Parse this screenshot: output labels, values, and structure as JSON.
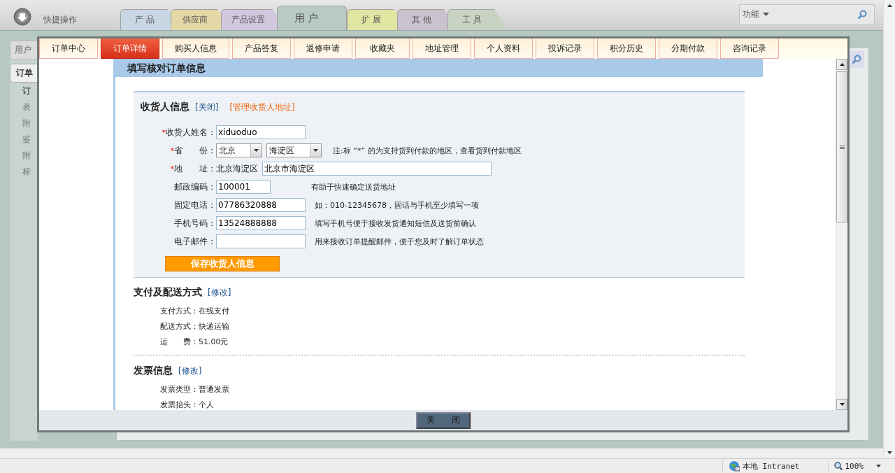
{
  "toolbar": {
    "quick_label": "快捷操作",
    "tabs": [
      {
        "label": "产 品",
        "selected": false,
        "color": "#c9d7e4"
      },
      {
        "label": "供应商",
        "selected": false,
        "color": "#e6d8a6"
      },
      {
        "label": "产品设置",
        "selected": false,
        "color": "#d2c8de"
      },
      {
        "label": "用 户",
        "selected": true,
        "color": "#b9cac2"
      },
      {
        "label": "扩 展",
        "selected": false,
        "color": "#e0e5a2"
      },
      {
        "label": "其 他",
        "selected": false,
        "color": "#cac2ce"
      },
      {
        "label": "工 具",
        "selected": false,
        "color": "#c9d3c4"
      }
    ],
    "search": {
      "label": "功能"
    }
  },
  "sidebar": {
    "title": "用户",
    "tab": {
      "label": "订单",
      "selected": true
    },
    "items": [
      {
        "label": "订",
        "kind": "heading"
      },
      {
        "label": "表",
        "kind": "link"
      },
      {
        "label": "附",
        "kind": "link"
      },
      {
        "label": "鉴",
        "kind": "link"
      },
      {
        "label": "附",
        "kind": "link"
      },
      {
        "label": "标",
        "kind": "link"
      }
    ]
  },
  "dialog": {
    "tabs": [
      {
        "label": "订单中心",
        "selected": false
      },
      {
        "label": "订单详情",
        "selected": true
      },
      {
        "label": "购买人信息",
        "selected": false
      },
      {
        "label": "产品答复",
        "selected": false
      },
      {
        "label": "返修申请",
        "selected": false
      },
      {
        "label": "收藏夹",
        "selected": false
      },
      {
        "label": "地址管理",
        "selected": false
      },
      {
        "label": "个人资料",
        "selected": false
      },
      {
        "label": "投诉记录",
        "selected": false
      },
      {
        "label": "积分历史",
        "selected": false
      },
      {
        "label": "分期付款",
        "selected": false
      },
      {
        "label": "咨询记录",
        "selected": false
      }
    ],
    "form_title": "填写核对订单信息",
    "consignee": {
      "title": "收货人信息",
      "links": [
        {
          "label": "[关闭]",
          "kind": "plain"
        },
        {
          "label": "[管理收货人地址]",
          "kind": "accent"
        }
      ],
      "fields": [
        {
          "kind": "text",
          "mark": "*",
          "label": "收货人姓名：",
          "value": "xiduoduo"
        },
        {
          "kind": "select",
          "mark": "*",
          "label": "省　　份：",
          "selects": [
            "北京",
            "海淀区"
          ],
          "note": "注:标 “*” 的为支持货到付款的地区，查看货到付款地区"
        },
        {
          "kind": "address",
          "mark": "*",
          "label": "地　　址：",
          "prefix": "北京海淀区",
          "value": "北京市海淀区"
        },
        {
          "kind": "short",
          "label": "邮政编码：",
          "value": "100001",
          "note": "有助于快速确定送货地址"
        },
        {
          "kind": "text",
          "label": "固定电话：",
          "value": "07786320888",
          "note": "如：010-12345678，固话与手机至少填写一项"
        },
        {
          "kind": "text",
          "label": "手机号码：",
          "value": "13524888888",
          "note": "填写手机号便于接收发货通知短信及送货前确认"
        },
        {
          "kind": "text",
          "label": "电子邮件：",
          "note": "用来接收订单提醒邮件，便于您及时了解订单状态"
        }
      ],
      "save_button": "保存收货人信息"
    },
    "sections": [
      {
        "title": "支付及配送方式",
        "link": "[修改]",
        "rows": [
          {
            "label": "支付方式：",
            "value": "在线支付"
          },
          {
            "label": "配送方式：",
            "value": "快递运输"
          },
          {
            "label": "运　　费：",
            "value": "51.00元"
          }
        ]
      },
      {
        "title": "发票信息",
        "link": "[修改]",
        "rows": [
          {
            "label": "发票类型：",
            "value": "普通发票"
          },
          {
            "label": "发票抬头：",
            "value": "个人"
          }
        ]
      }
    ],
    "close_button": "关　　闭"
  },
  "status_bar": {
    "zone": "本地 Intranet",
    "zoom": "100%"
  }
}
